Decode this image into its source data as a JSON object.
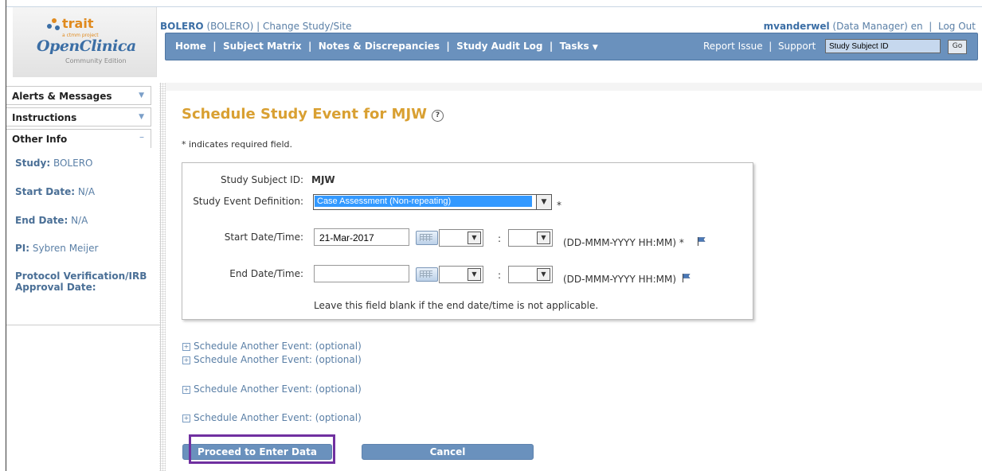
{
  "brand": {
    "trait": "trait",
    "trait_sub": "a ctmm project",
    "product": "OpenClinica",
    "edition": "Community Edition"
  },
  "header": {
    "study_bold": "BOLERO",
    "study_rest": " (BOLERO)  |  ",
    "change_study": "Change Study/Site",
    "user_bold": "mvanderwel",
    "user_role": " (Data Manager)",
    "lang": "en",
    "sep": "|",
    "logout": "Log Out"
  },
  "nav": {
    "home": "Home",
    "subject_matrix": "Subject Matrix",
    "notes": "Notes & Discrepancies",
    "audit_log": "Study Audit Log",
    "tasks": "Tasks",
    "report_issue": "Report Issue",
    "support": "Support",
    "search_value": "Study Subject ID",
    "go": "Go"
  },
  "sidebar": {
    "alerts": "Alerts & Messages",
    "instructions": "Instructions",
    "other_info": "Other Info",
    "study_label": "Study:",
    "study_value": "BOLERO",
    "start_label": "Start Date:",
    "start_value": "N/A",
    "end_label": "End Date:",
    "end_value": "N/A",
    "pi_label": "PI:",
    "pi_value": "Sybren Meijer",
    "protocol_label": "Protocol Verification/IRB Approval Date:"
  },
  "main": {
    "title": "Schedule Study Event for MJW",
    "required_note": "* indicates required field.",
    "subject_id_label": "Study Subject ID:",
    "subject_id_value": "MJW",
    "event_def_label": "Study Event Definition:",
    "event_def_value": "Case Assessment (Non-repeating)",
    "start_label": "Start Date/Time:",
    "start_value": "21-Mar-2017",
    "end_label": "End Date/Time:",
    "end_value": "",
    "format_required": "(DD-MMM-YYYY HH:MM) *",
    "format": "(DD-MMM-YYYY HH:MM)",
    "end_hint": "Leave this field blank if the end date/time is not applicable.",
    "schedule_another": [
      "Schedule Another Event: (optional)",
      "Schedule Another Event: (optional)",
      "Schedule Another Event: (optional)",
      "Schedule Another Event: (optional)"
    ],
    "proceed_button": "Proceed to Enter Data",
    "cancel_button": "Cancel"
  },
  "colors": {
    "accent_blue": "#6a91bd",
    "title_gold": "#d9a032",
    "link_blue": "#5a7fa6",
    "highlight_purple": "#7030a0"
  }
}
